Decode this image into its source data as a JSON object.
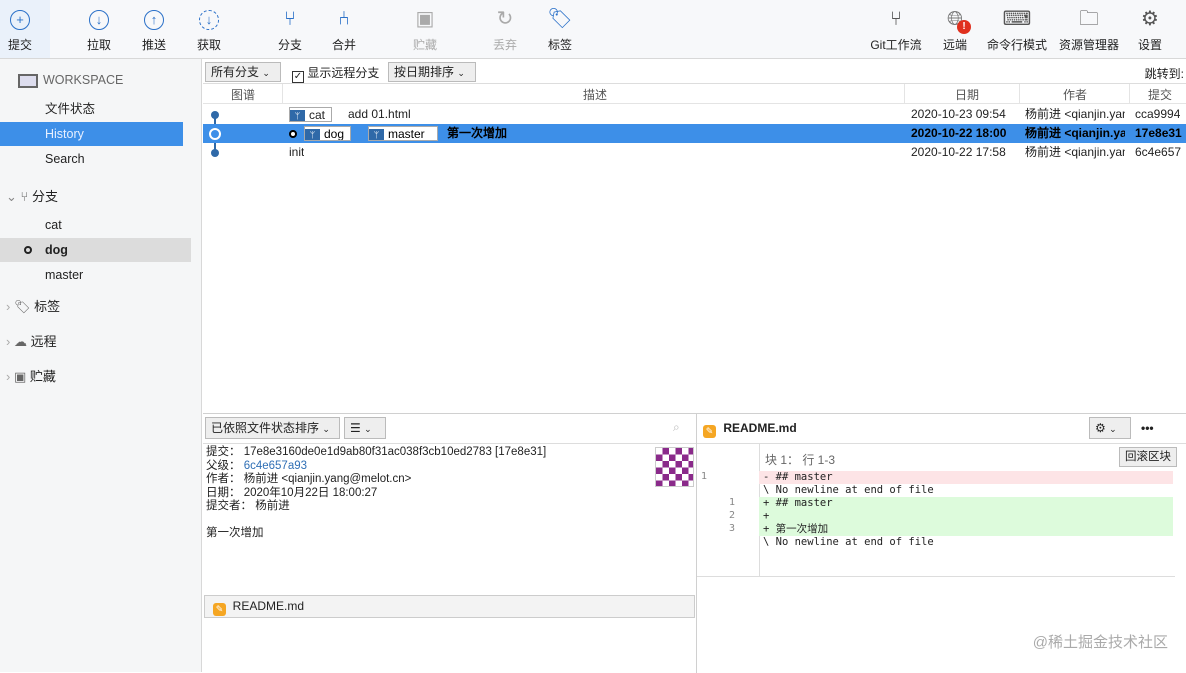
{
  "toolbar": {
    "commit": "提交",
    "pull": "拉取",
    "push": "推送",
    "fetch": "获取",
    "branch": "分支",
    "merge": "合并",
    "stash": "贮藏",
    "discard": "丢弃",
    "tag": "标签",
    "gitflow": "Git工作流",
    "remote": "远端",
    "terminal": "命令行模式",
    "explorer": "资源管理器",
    "settings": "设置",
    "remote_badge": "!"
  },
  "sidebar": {
    "workspace": "WORKSPACE",
    "file_status": "文件状态",
    "history": "History",
    "search": "Search",
    "branches": "分支",
    "branch_items": [
      "cat",
      "dog",
      "master"
    ],
    "tags": "标签",
    "remotes": "远程",
    "stashes": "贮藏"
  },
  "filter": {
    "branches": "所有分支",
    "show_remote": "显示远程分支",
    "sort": "按日期排序",
    "jump_to": "跳转到:"
  },
  "columns": {
    "graph": "图谱",
    "description": "描述",
    "date": "日期",
    "author": "作者",
    "commit": "提交"
  },
  "commits": [
    {
      "tags": [
        "cat"
      ],
      "message": "add 01.html",
      "date": "2020-10-23 09:54",
      "author": "杨前进 <qianjin.yang@melot.cn>",
      "hash": "cca9994"
    },
    {
      "tags": [
        "dog",
        "master"
      ],
      "message": "第一次增加",
      "date": "2020-10-22 18:00",
      "author": "杨前进 <qianjin.yang@melot.cn>",
      "hash": "17e8e31"
    },
    {
      "tags": [],
      "message": "init",
      "date": "2020-10-22 17:58",
      "author": "杨前进 <qianjin.yang@melot.cn>",
      "hash": "6c4e657"
    }
  ],
  "details": {
    "sort": "已依照文件状态排序",
    "commit_label": "提交：",
    "commit_value": "17e8e3160de0e1d9ab80f31ac038f3cb10ed2783 [17e8e31]",
    "parent_label": "父级：",
    "parent_value": "6c4e657a93",
    "author_label": "作者：",
    "author_value": "杨前进 <qianjin.yang@melot.cn>",
    "date_label": "日期：",
    "date_value": "2020年10月22日 18:00:27",
    "committer_label": "提交者：",
    "committer_value": "杨前进",
    "message": "第一次增加",
    "file": "README.md"
  },
  "diff": {
    "file": "README.md",
    "hunk": "块 1： 行 1-3",
    "revert": "回滚区块",
    "lines": [
      {
        "old": "1",
        "new": "",
        "text": "- ## master",
        "type": "del"
      },
      {
        "old": "",
        "new": "",
        "text": "\\ No newline at end of file",
        "type": "ctx"
      },
      {
        "old": "",
        "new": "1",
        "text": "+ ## master",
        "type": "add"
      },
      {
        "old": "",
        "new": "2",
        "text": "+",
        "type": "add"
      },
      {
        "old": "",
        "new": "3",
        "text": "+ 第一次增加",
        "type": "add"
      },
      {
        "old": "",
        "new": "",
        "text": "\\ No newline at end of file",
        "type": "ctx"
      }
    ]
  },
  "watermark": "@稀土掘金技术社区",
  "colors": {
    "accent": "#3d8fe8",
    "del": "#fde4e6",
    "add": "#ddfbdc"
  }
}
